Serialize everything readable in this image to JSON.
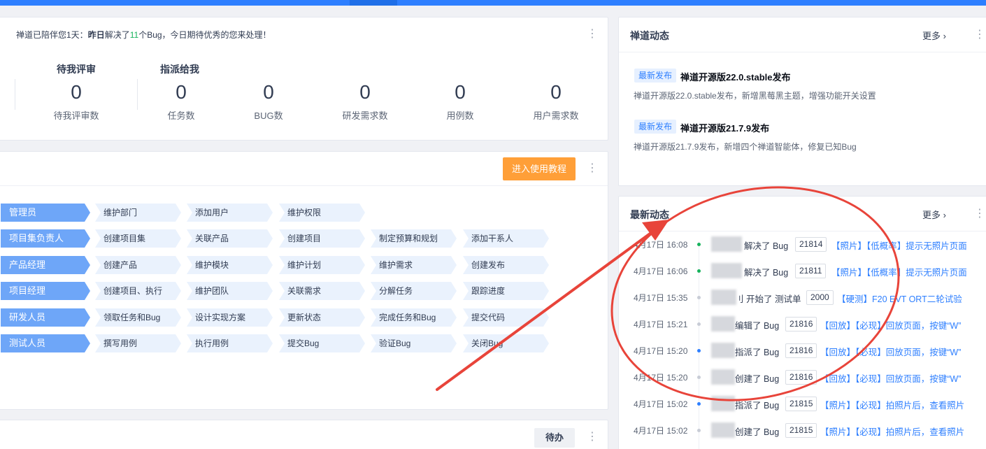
{
  "colors": {
    "accent": "#2e7fff",
    "orange": "#ff9f38",
    "green": "#17b35c",
    "annotation": "#e8443a",
    "role_bg": "#6ea6f8",
    "step_bg": "#eaf2fd"
  },
  "welcome": {
    "prefix": "禅道已陪伴您1天：",
    "bold": "昨日",
    "mid": "解决了",
    "count": "11",
    "suffix": "个Bug，今日期待优秀的您来处理！",
    "group_review": "待我评审",
    "group_assigned": "指派给我",
    "stats": [
      {
        "value": "0",
        "label": "待我评审数"
      },
      {
        "value": "0",
        "label": "任务数"
      },
      {
        "value": "0",
        "label": "BUG数"
      },
      {
        "value": "0",
        "label": "研发需求数"
      },
      {
        "value": "0",
        "label": "用例数"
      },
      {
        "value": "0",
        "label": "用户需求数"
      }
    ]
  },
  "flow": {
    "tutorial_button": "进入使用教程",
    "rows": [
      {
        "role": "管理员",
        "steps": [
          "维护部门",
          "添加用户",
          "维护权限"
        ]
      },
      {
        "role": "项目集负责人",
        "steps": [
          "创建项目集",
          "关联产品",
          "创建项目",
          "制定预算和规划",
          "添加干系人"
        ]
      },
      {
        "role": "产品经理",
        "steps": [
          "创建产品",
          "维护模块",
          "维护计划",
          "维护需求",
          "创建发布"
        ]
      },
      {
        "role": "项目经理",
        "steps": [
          "创建项目、执行",
          "维护团队",
          "关联需求",
          "分解任务",
          "跟踪进度"
        ]
      },
      {
        "role": "研发人员",
        "steps": [
          "领取任务和Bug",
          "设计实现方案",
          "更新状态",
          "完成任务和Bug",
          "提交代码"
        ]
      },
      {
        "role": "测试人员",
        "steps": [
          "撰写用例",
          "执行用例",
          "提交Bug",
          "验证Bug",
          "关闭Bug"
        ]
      }
    ]
  },
  "todo": {
    "button": "待办"
  },
  "news": {
    "title": "禅道动态",
    "more": "更多",
    "items": [
      {
        "tag": "最新发布",
        "title": "禅道开源版22.0.stable发布",
        "desc": "禅道开源版22.0.stable发布，新增黑莓黑主题，增强功能开关设置"
      },
      {
        "tag": "最新发布",
        "title": "禅道开源版21.7.9发布",
        "desc": "禅道开源版21.7.9发布，新增四个禅道智能体，修复已知Bug"
      }
    ]
  },
  "activity": {
    "title": "最新动态",
    "more": "更多",
    "items": [
      {
        "time": "4月17日 16:08",
        "dot": "#17b35c",
        "action": "解决了 Bug",
        "id": "21814",
        "title": "【照片】【低概率】提示无照片页面"
      },
      {
        "time": "4月17日 16:06",
        "dot": "#17b35c",
        "action": "解决了 Bug",
        "id": "21811",
        "title": "【照片】【低概率】提示无照片页面"
      },
      {
        "time": "4月17日 15:35",
        "dot": "#c8ccd6",
        "action": "刂 开始了 测试单",
        "id": "2000",
        "title": "【硬测】F20 EVT ORT二轮试验"
      },
      {
        "time": "4月17日 15:21",
        "dot": "#c8ccd6",
        "action": "编辑了 Bug",
        "id": "21816",
        "title": "【回放】【必现】回放页面，按键“W”"
      },
      {
        "time": "4月17日 15:20",
        "dot": "#2e7fff",
        "action": "指派了 Bug",
        "id": "21816",
        "title": "【回放】【必现】回放页面，按键“W”"
      },
      {
        "time": "4月17日 15:20",
        "dot": "#c8ccd6",
        "action": "创建了 Bug",
        "id": "21816",
        "title": "【回放】【必现】回放页面，按键“W”"
      },
      {
        "time": "4月17日 15:02",
        "dot": "#2e7fff",
        "action": "指派了 Bug",
        "id": "21815",
        "title": "【照片】【必现】拍照片后，查看照片"
      },
      {
        "time": "4月17日 15:02",
        "dot": "#c8ccd6",
        "action": "创建了 Bug",
        "id": "21815",
        "title": "【照片】【必现】拍照片后，查看照片"
      }
    ]
  }
}
